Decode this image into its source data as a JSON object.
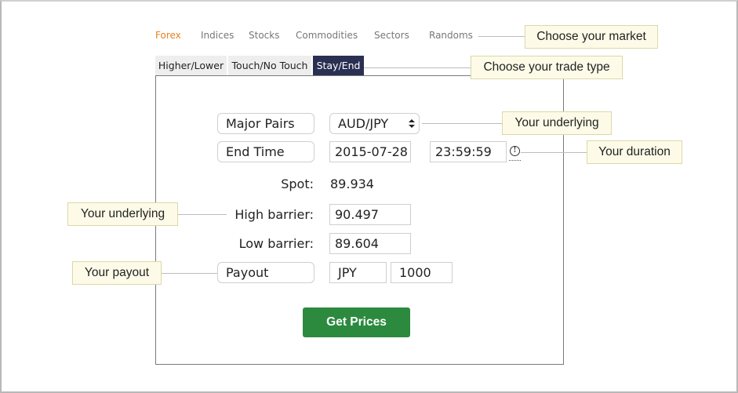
{
  "market_nav": {
    "items": [
      "Forex",
      "Indices",
      "Stocks",
      "Commodities",
      "Sectors",
      "Randoms"
    ],
    "active": "Forex",
    "accent_color": "#e98024"
  },
  "trade_tabs": {
    "items": [
      "Higher/Lower",
      "Touch/No Touch",
      "Stay/End"
    ],
    "active": "Stay/End",
    "active_color": "#2a3052"
  },
  "form": {
    "market_select": "Major Pairs",
    "underlying_select": "AUD/JPY",
    "duration_type": "End Time",
    "end_date": "2015-07-28",
    "end_time": "23:59:59",
    "spot_label": "Spot:",
    "spot_value": "89.934",
    "high_barrier_label": "High barrier:",
    "high_barrier_value": "90.497",
    "low_barrier_label": "Low barrier:",
    "low_barrier_value": "89.604",
    "payout_select": "Payout",
    "currency": "JPY",
    "amount": "1000",
    "get_prices_label": "Get Prices",
    "button_color": "#2b8a3e"
  },
  "callouts": {
    "market": "Choose your market",
    "trade_type": "Choose your trade type",
    "underlying_right": "Your underlying",
    "duration": "Your duration",
    "underlying_left": "Your underlying",
    "payout": "Your payout",
    "background_color": "#fdfbe8"
  },
  "icons": {
    "info": "info-circle-icon"
  }
}
